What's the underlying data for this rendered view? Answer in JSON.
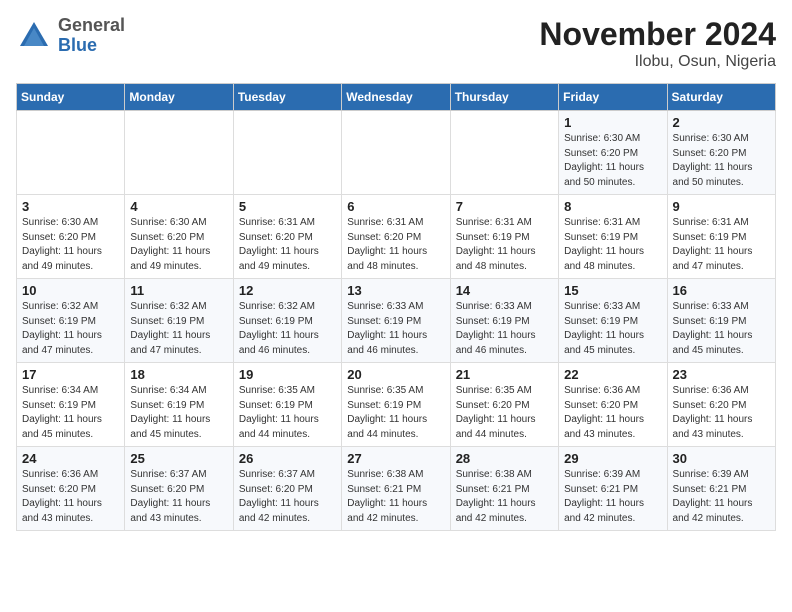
{
  "logo": {
    "general": "General",
    "blue": "Blue"
  },
  "header": {
    "month_title": "November 2024",
    "location": "Ilobu, Osun, Nigeria"
  },
  "days_of_week": [
    "Sunday",
    "Monday",
    "Tuesday",
    "Wednesday",
    "Thursday",
    "Friday",
    "Saturday"
  ],
  "weeks": [
    [
      {
        "day": "",
        "info": ""
      },
      {
        "day": "",
        "info": ""
      },
      {
        "day": "",
        "info": ""
      },
      {
        "day": "",
        "info": ""
      },
      {
        "day": "",
        "info": ""
      },
      {
        "day": "1",
        "info": "Sunrise: 6:30 AM\nSunset: 6:20 PM\nDaylight: 11 hours\nand 50 minutes."
      },
      {
        "day": "2",
        "info": "Sunrise: 6:30 AM\nSunset: 6:20 PM\nDaylight: 11 hours\nand 50 minutes."
      }
    ],
    [
      {
        "day": "3",
        "info": "Sunrise: 6:30 AM\nSunset: 6:20 PM\nDaylight: 11 hours\nand 49 minutes."
      },
      {
        "day": "4",
        "info": "Sunrise: 6:30 AM\nSunset: 6:20 PM\nDaylight: 11 hours\nand 49 minutes."
      },
      {
        "day": "5",
        "info": "Sunrise: 6:31 AM\nSunset: 6:20 PM\nDaylight: 11 hours\nand 49 minutes."
      },
      {
        "day": "6",
        "info": "Sunrise: 6:31 AM\nSunset: 6:20 PM\nDaylight: 11 hours\nand 48 minutes."
      },
      {
        "day": "7",
        "info": "Sunrise: 6:31 AM\nSunset: 6:19 PM\nDaylight: 11 hours\nand 48 minutes."
      },
      {
        "day": "8",
        "info": "Sunrise: 6:31 AM\nSunset: 6:19 PM\nDaylight: 11 hours\nand 48 minutes."
      },
      {
        "day": "9",
        "info": "Sunrise: 6:31 AM\nSunset: 6:19 PM\nDaylight: 11 hours\nand 47 minutes."
      }
    ],
    [
      {
        "day": "10",
        "info": "Sunrise: 6:32 AM\nSunset: 6:19 PM\nDaylight: 11 hours\nand 47 minutes."
      },
      {
        "day": "11",
        "info": "Sunrise: 6:32 AM\nSunset: 6:19 PM\nDaylight: 11 hours\nand 47 minutes."
      },
      {
        "day": "12",
        "info": "Sunrise: 6:32 AM\nSunset: 6:19 PM\nDaylight: 11 hours\nand 46 minutes."
      },
      {
        "day": "13",
        "info": "Sunrise: 6:33 AM\nSunset: 6:19 PM\nDaylight: 11 hours\nand 46 minutes."
      },
      {
        "day": "14",
        "info": "Sunrise: 6:33 AM\nSunset: 6:19 PM\nDaylight: 11 hours\nand 46 minutes."
      },
      {
        "day": "15",
        "info": "Sunrise: 6:33 AM\nSunset: 6:19 PM\nDaylight: 11 hours\nand 45 minutes."
      },
      {
        "day": "16",
        "info": "Sunrise: 6:33 AM\nSunset: 6:19 PM\nDaylight: 11 hours\nand 45 minutes."
      }
    ],
    [
      {
        "day": "17",
        "info": "Sunrise: 6:34 AM\nSunset: 6:19 PM\nDaylight: 11 hours\nand 45 minutes."
      },
      {
        "day": "18",
        "info": "Sunrise: 6:34 AM\nSunset: 6:19 PM\nDaylight: 11 hours\nand 45 minutes."
      },
      {
        "day": "19",
        "info": "Sunrise: 6:35 AM\nSunset: 6:19 PM\nDaylight: 11 hours\nand 44 minutes."
      },
      {
        "day": "20",
        "info": "Sunrise: 6:35 AM\nSunset: 6:19 PM\nDaylight: 11 hours\nand 44 minutes."
      },
      {
        "day": "21",
        "info": "Sunrise: 6:35 AM\nSunset: 6:20 PM\nDaylight: 11 hours\nand 44 minutes."
      },
      {
        "day": "22",
        "info": "Sunrise: 6:36 AM\nSunset: 6:20 PM\nDaylight: 11 hours\nand 43 minutes."
      },
      {
        "day": "23",
        "info": "Sunrise: 6:36 AM\nSunset: 6:20 PM\nDaylight: 11 hours\nand 43 minutes."
      }
    ],
    [
      {
        "day": "24",
        "info": "Sunrise: 6:36 AM\nSunset: 6:20 PM\nDaylight: 11 hours\nand 43 minutes."
      },
      {
        "day": "25",
        "info": "Sunrise: 6:37 AM\nSunset: 6:20 PM\nDaylight: 11 hours\nand 43 minutes."
      },
      {
        "day": "26",
        "info": "Sunrise: 6:37 AM\nSunset: 6:20 PM\nDaylight: 11 hours\nand 42 minutes."
      },
      {
        "day": "27",
        "info": "Sunrise: 6:38 AM\nSunset: 6:21 PM\nDaylight: 11 hours\nand 42 minutes."
      },
      {
        "day": "28",
        "info": "Sunrise: 6:38 AM\nSunset: 6:21 PM\nDaylight: 11 hours\nand 42 minutes."
      },
      {
        "day": "29",
        "info": "Sunrise: 6:39 AM\nSunset: 6:21 PM\nDaylight: 11 hours\nand 42 minutes."
      },
      {
        "day": "30",
        "info": "Sunrise: 6:39 AM\nSunset: 6:21 PM\nDaylight: 11 hours\nand 42 minutes."
      }
    ]
  ]
}
